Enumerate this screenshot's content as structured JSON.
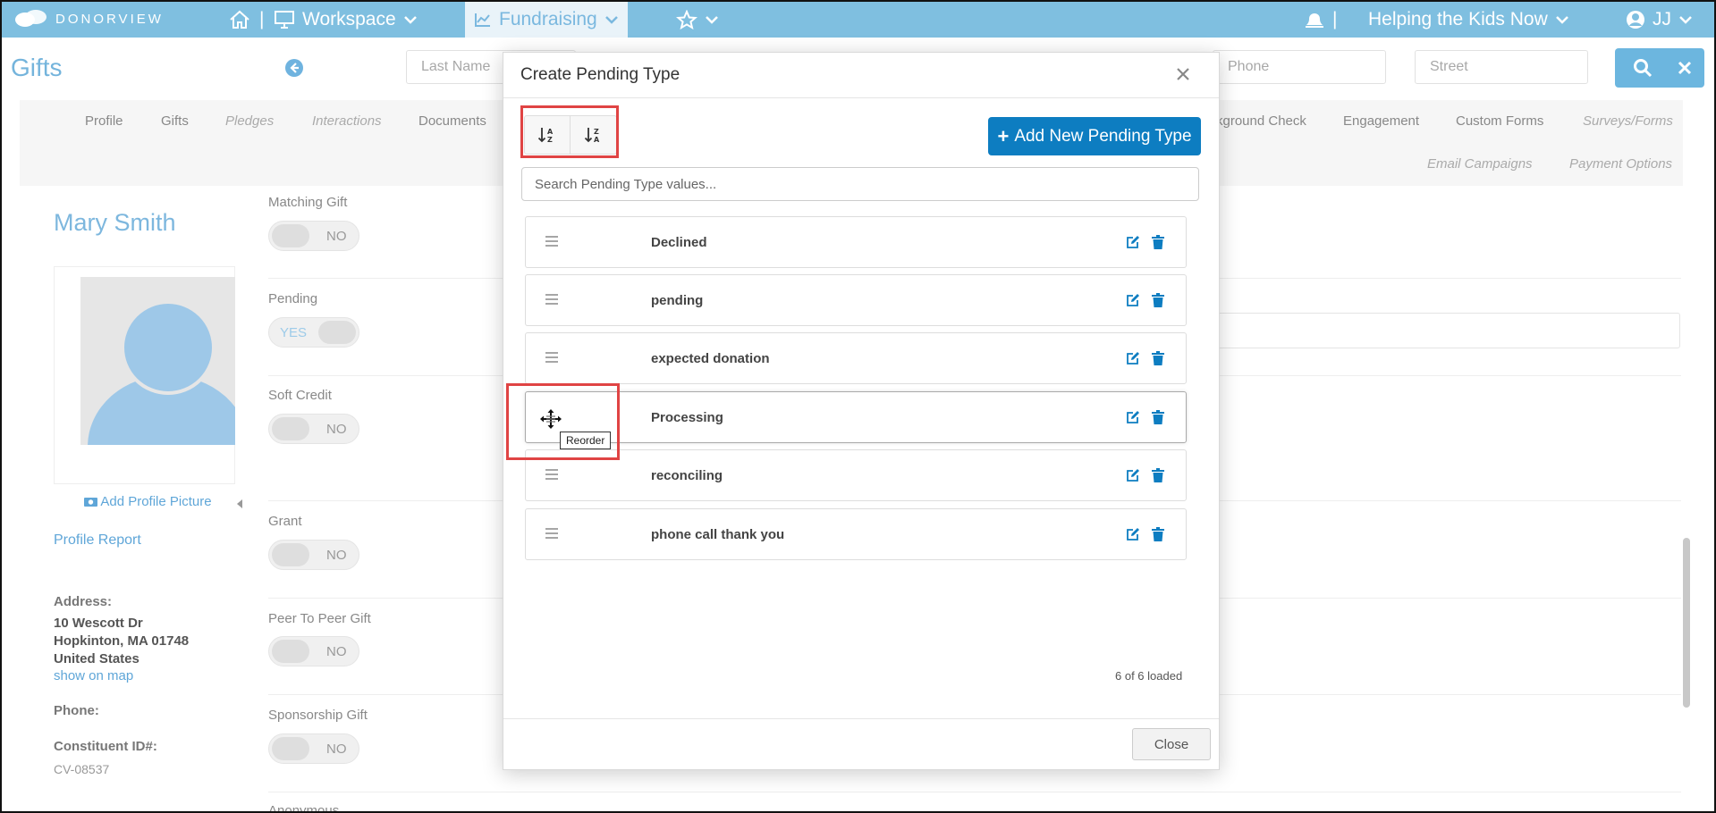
{
  "topnav": {
    "brand": "DONORVIEW",
    "workspace": "Workspace",
    "fundraising": "Fundraising",
    "org": "Helping the Kids Now",
    "user": "JJ",
    "separator": "|"
  },
  "page": {
    "title": "Gifts",
    "search": {
      "last_name": "Last Name",
      "phone": "Phone",
      "street": "Street"
    },
    "tabs": [
      "Profile",
      "Gifts",
      "Pledges",
      "Interactions",
      "Documents",
      "kground Check",
      "Engagement",
      "Custom Forms",
      "Surveys/Forms",
      "Email Campaigns",
      "Payment Options"
    ],
    "profile": {
      "name": "Mary Smith",
      "add_picture": "Add Profile Picture",
      "report": "Profile Report",
      "address_label": "Address:",
      "address_lines": [
        "10 Wescott Dr",
        "Hopkinton, MA 01748",
        "United States"
      ],
      "show_on_map": "show on map",
      "phone_label": "Phone:",
      "constituent_label": "Constituent ID#:",
      "constituent_id": "CV-08537"
    },
    "fields": [
      {
        "label": "Matching Gift",
        "state": "NO"
      },
      {
        "label": "Pending",
        "state": "YES"
      },
      {
        "label": "Soft Credit",
        "state": "NO"
      },
      {
        "label": "Grant",
        "state": "NO"
      },
      {
        "label": "Peer To Peer Gift",
        "state": "NO"
      },
      {
        "label": "Sponsorship Gift",
        "state": "NO"
      },
      {
        "label": "Anonymous",
        "state": ""
      }
    ]
  },
  "modal": {
    "title": "Create Pending Type",
    "add_button": "Add New Pending Type",
    "search_placeholder": "Search Pending Type values...",
    "items": [
      "Declined",
      "pending",
      "expected donation",
      "Processing",
      "reconciling",
      "phone call thank you"
    ],
    "tooltip": "Reorder",
    "loaded": "6 of 6 loaded",
    "close": "Close"
  },
  "colors": {
    "accent": "#0d7dc1",
    "nav": "#7fbfe0",
    "highlight": "#e04444",
    "link": "#5fa6d8"
  }
}
